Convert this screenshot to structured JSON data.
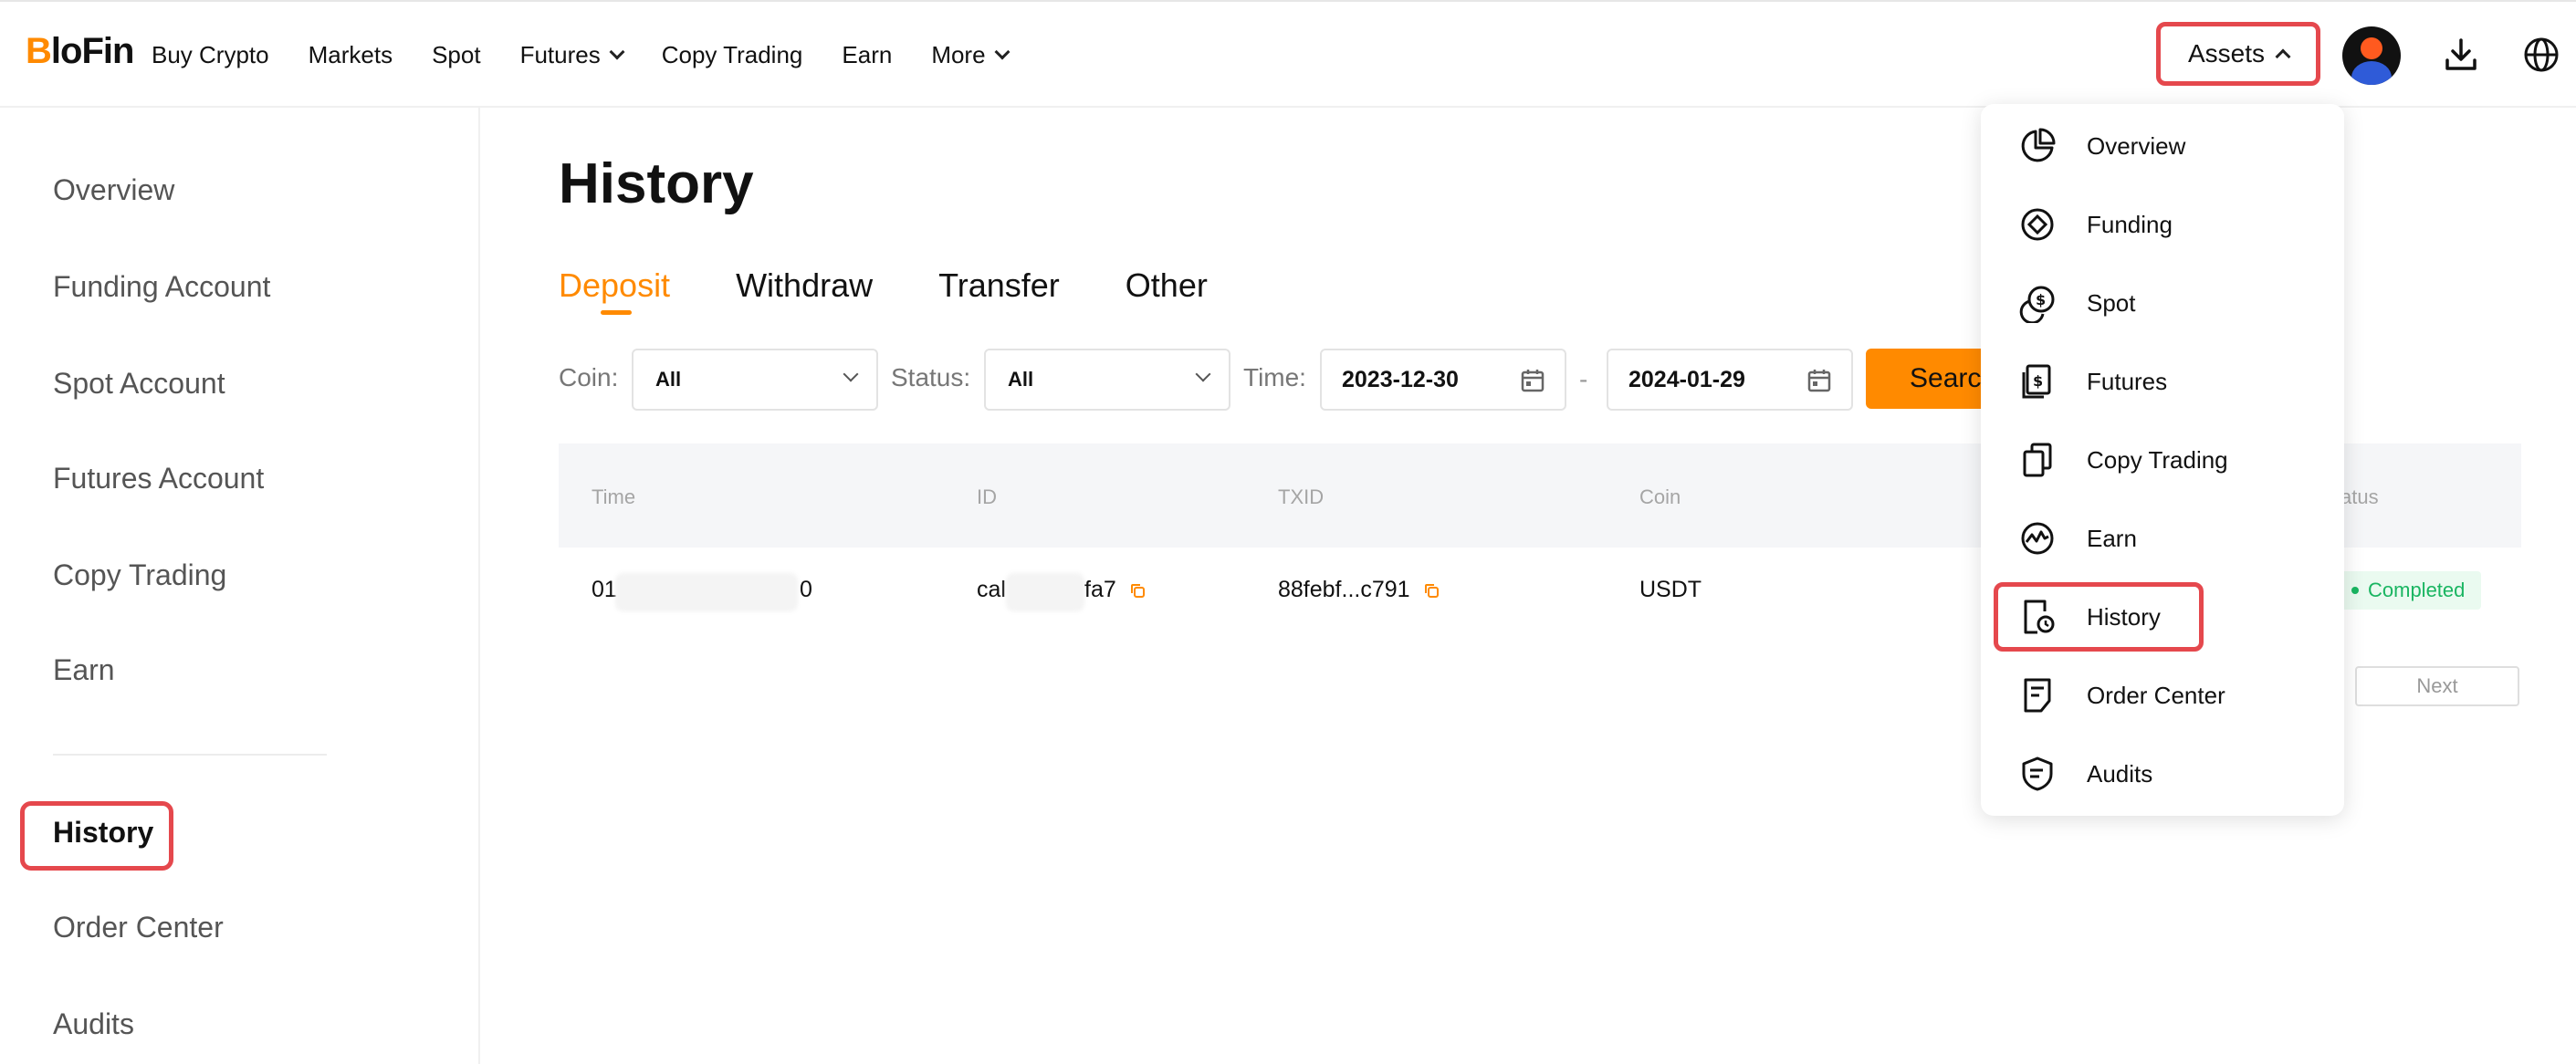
{
  "brand": {
    "logo_mark": "B",
    "logo_rest": "loFin",
    "accent_color": "#ff8a00",
    "highlight_color": "#e5484d"
  },
  "topnav": {
    "items": [
      {
        "label": "Buy Crypto",
        "has_dropdown": false
      },
      {
        "label": "Markets",
        "has_dropdown": false
      },
      {
        "label": "Spot",
        "has_dropdown": false
      },
      {
        "label": "Futures",
        "has_dropdown": true
      },
      {
        "label": "Copy Trading",
        "has_dropdown": false
      },
      {
        "label": "Earn",
        "has_dropdown": false
      },
      {
        "label": "More",
        "has_dropdown": true
      }
    ],
    "assets_label": "Assets",
    "icons": [
      "avatar",
      "download-icon",
      "globe-icon"
    ]
  },
  "sidebar": {
    "items": [
      {
        "label": "Overview",
        "active": false
      },
      {
        "label": "Funding Account",
        "active": false
      },
      {
        "label": "Spot Account",
        "active": false
      },
      {
        "label": "Futures Account",
        "active": false
      },
      {
        "label": "Copy Trading",
        "active": false
      },
      {
        "label": "Earn",
        "active": false
      },
      {
        "label": "History",
        "active": true
      },
      {
        "label": "Order Center",
        "active": false
      },
      {
        "label": "Audits",
        "active": false
      }
    ]
  },
  "main": {
    "title": "History",
    "tabs": [
      {
        "label": "Deposit",
        "active": true
      },
      {
        "label": "Withdraw",
        "active": false
      },
      {
        "label": "Transfer",
        "active": false
      },
      {
        "label": "Other",
        "active": false
      }
    ],
    "filters": {
      "coin_label": "Coin:",
      "coin_value": "All",
      "status_label": "Status:",
      "status_value": "All",
      "time_label": "Time:",
      "date_from": "2023-12-30",
      "date_separator": "-",
      "date_to": "2024-01-29",
      "search_label": "Search"
    },
    "table": {
      "columns": [
        "Time",
        "ID",
        "TXID",
        "Coin",
        "atus"
      ],
      "rows": [
        {
          "time_prefix": "01",
          "time_suffix": "0",
          "id_prefix": "cal",
          "id_suffix": "fa7",
          "txid": "88febf...c791",
          "coin": "USDT",
          "status": "Completed"
        }
      ]
    },
    "pagination": {
      "next_label": "Next"
    }
  },
  "assets_menu": {
    "items": [
      {
        "label": "Overview",
        "icon": "pie-chart-icon"
      },
      {
        "label": "Funding",
        "icon": "funding-diamond-icon"
      },
      {
        "label": "Spot",
        "icon": "coins-icon"
      },
      {
        "label": "Futures",
        "icon": "futures-doc-icon"
      },
      {
        "label": "Copy Trading",
        "icon": "copy-icon"
      },
      {
        "label": "Earn",
        "icon": "earn-pulse-icon"
      },
      {
        "label": "History",
        "icon": "history-doc-icon"
      },
      {
        "label": "Order Center",
        "icon": "order-doc-icon"
      },
      {
        "label": "Audits",
        "icon": "audit-shield-icon"
      }
    ]
  }
}
